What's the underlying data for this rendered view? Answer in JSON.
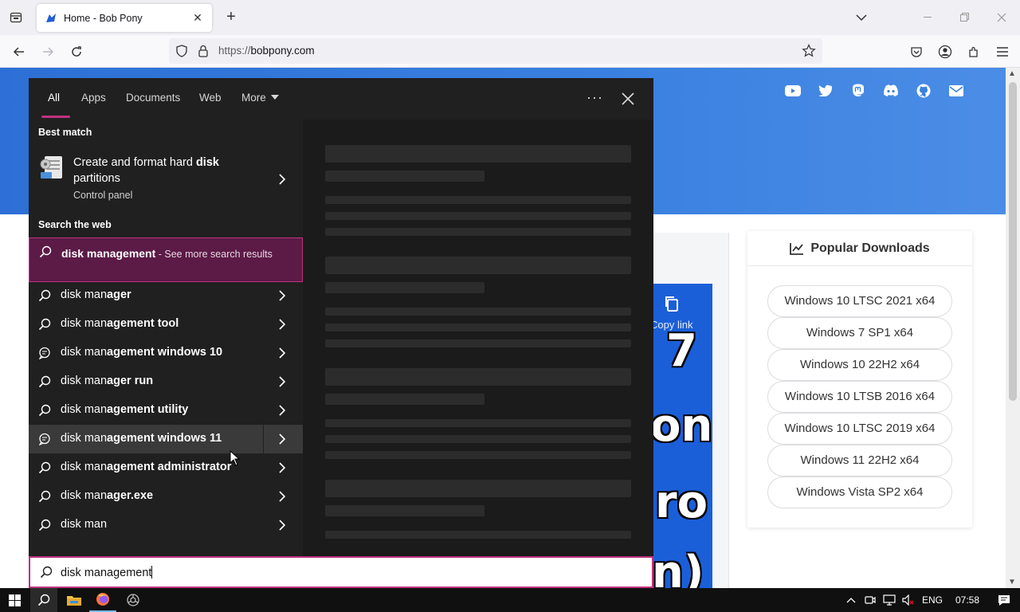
{
  "browser": {
    "tab_title": "Home - Bob Pony",
    "url_prefix": "https://",
    "url_domain": "bobpony.com"
  },
  "page": {
    "downloads_title": "Popular Downloads",
    "downloads": [
      "Windows 10 LTSC 2021 x64",
      "Windows 7 SP1 x64",
      "Windows 10 22H2 x64",
      "Windows 10 LTSB 2016 x64",
      "Windows 10 LTSC 2019 x64",
      "Windows 11 22H2 x64",
      "Windows Vista SP2 x64"
    ],
    "copy_link": "Copy link",
    "video_chars": [
      "7",
      "on",
      "ro",
      "n)"
    ]
  },
  "search": {
    "tabs": [
      "All",
      "Apps",
      "Documents",
      "Web",
      "More"
    ],
    "best_match_header": "Best match",
    "best_match": {
      "title_plain": "Create and format hard ",
      "title_bold": "disk",
      "title_end": "partitions",
      "subtitle": "Control panel"
    },
    "web_header": "Search the web",
    "web_top": {
      "bold": "disk management",
      "more": " - See more search results"
    },
    "suggestions": [
      {
        "prefix": "disk man",
        "rest": "ager",
        "icon": "search"
      },
      {
        "prefix": "disk man",
        "rest": "agement tool",
        "icon": "search"
      },
      {
        "prefix": "disk man",
        "rest": "agement windows 10",
        "icon": "chat"
      },
      {
        "prefix": "disk man",
        "rest": "ager run",
        "icon": "search"
      },
      {
        "prefix": "disk man",
        "rest": "agement utility",
        "icon": "search"
      },
      {
        "prefix": "disk man",
        "rest": "agement windows 11",
        "icon": "chat"
      },
      {
        "prefix": "disk man",
        "rest": "agement administrator",
        "icon": "search"
      },
      {
        "prefix": "disk man",
        "rest": "ager.exe",
        "icon": "search"
      },
      {
        "prefix": "disk man",
        "rest": "",
        "icon": "search"
      }
    ],
    "query": "disk management"
  },
  "taskbar": {
    "lang": "ENG",
    "time": "07:58"
  },
  "colors": {
    "accent": "#c0327f",
    "highlight": "#5c1a47",
    "hero": "#3a80e0"
  }
}
